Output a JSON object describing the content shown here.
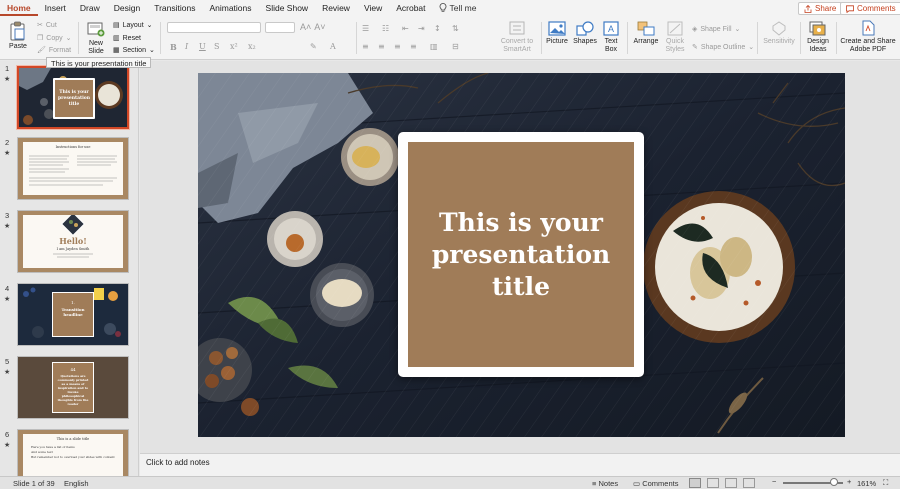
{
  "tabs": [
    "Home",
    "Insert",
    "Draw",
    "Design",
    "Transitions",
    "Animations",
    "Slide Show",
    "Review",
    "View",
    "Acrobat"
  ],
  "tell_me": "Tell me",
  "share_label": "Share",
  "comments_label": "Comments",
  "ribbon": {
    "paste": "Paste",
    "cut": "Cut",
    "copy": "Copy",
    "format": "Format",
    "new_slide_line1": "New",
    "new_slide_line2": "Slide",
    "layout": "Layout",
    "reset": "Reset",
    "section": "Section",
    "convert_line1": "Convert to",
    "convert_line2": "SmartArt",
    "picture": "Picture",
    "shapes": "Shapes",
    "textbox_line1": "Text",
    "textbox_line2": "Box",
    "arrange": "Arrange",
    "quick_line1": "Quick",
    "quick_line2": "Styles",
    "shape_fill": "Shape Fill",
    "shape_outline": "Shape Outline",
    "sensitivity": "Sensitivity",
    "design_line1": "Design",
    "design_line2": "Ideas",
    "adobe_line1": "Create and Share",
    "adobe_line2": "Adobe PDF"
  },
  "tooltip": "This is your presentation title",
  "thumbnails": {
    "numbers": [
      "1",
      "2",
      "3",
      "4",
      "5",
      "6"
    ],
    "t1_title": "This is your presentation title",
    "t2_heading": "Instructions for use",
    "t3_hello": "Hello!",
    "t3_name": "I am Jayden Smith",
    "t4_num": "1.",
    "t4_title": "Transition headline",
    "t5_num": "44",
    "t5_quote": "Quotations are commonly printed as a means of inspiration and to invoke philosophical thoughts from the reader",
    "t6_title": "This is a slide title",
    "t6_b1": "Here you have a list of items",
    "t6_b2": "And some text",
    "t6_b3": "But remember not to overload your slides with content"
  },
  "slide": {
    "title": "This is your presentation title"
  },
  "notes_placeholder": "Click to add notes",
  "status": {
    "slide_info": "Slide 1 of 39",
    "language": "English",
    "notes": "Notes",
    "comments": "Comments",
    "zoom": "161%"
  },
  "colors": {
    "accent": "#b7472a",
    "title_fill": "#a07c58",
    "slide_bg": "#1c2331"
  }
}
